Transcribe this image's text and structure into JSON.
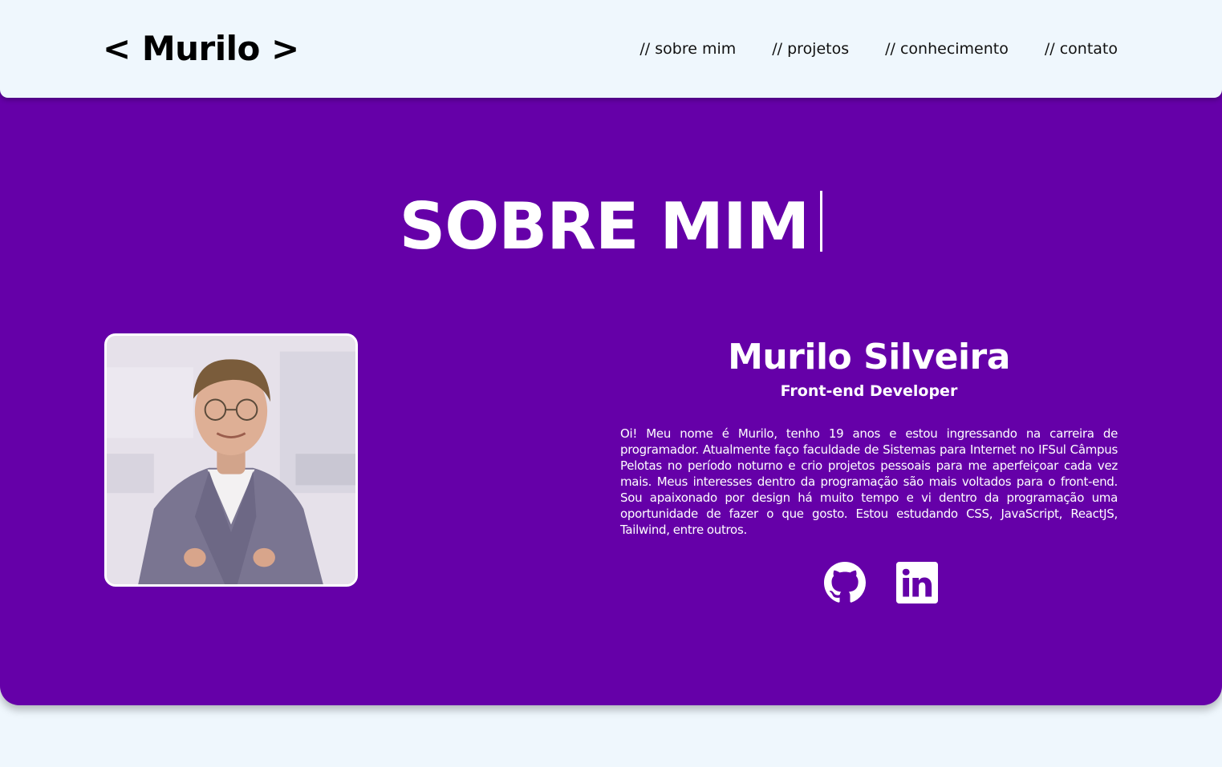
{
  "header": {
    "logo": "< Murilo >",
    "nav": [
      {
        "label": "// sobre mim"
      },
      {
        "label": "// projetos"
      },
      {
        "label": "// conhecimento"
      },
      {
        "label": "// contato"
      }
    ]
  },
  "about": {
    "title": "SOBRE MIM",
    "name": "Murilo Silveira",
    "role": "Front-end Developer",
    "bio": "Oi! Meu nome é Murilo, tenho 19 anos e estou ingressando na carreira de programador. Atualmente faço faculdade de Sistemas para Internet no IFSul Câmpus Pelotas no período noturno e crio projetos pessoais para me aperfeiçoar cada vez mais. Meus interesses dentro da programação são mais voltados para o front-end. Sou apaixonado por design há muito tempo e vi dentro da programação uma oportunidade de fazer o que gosto. Estou estudando CSS, JavaScript, ReactJS, Tailwind, entre outros.",
    "socials": [
      {
        "icon": "github-icon"
      },
      {
        "icon": "linkedin-icon"
      }
    ]
  },
  "colors": {
    "accent": "#6500a8",
    "background": "#eff7fd",
    "text_light": "#ffffff"
  }
}
